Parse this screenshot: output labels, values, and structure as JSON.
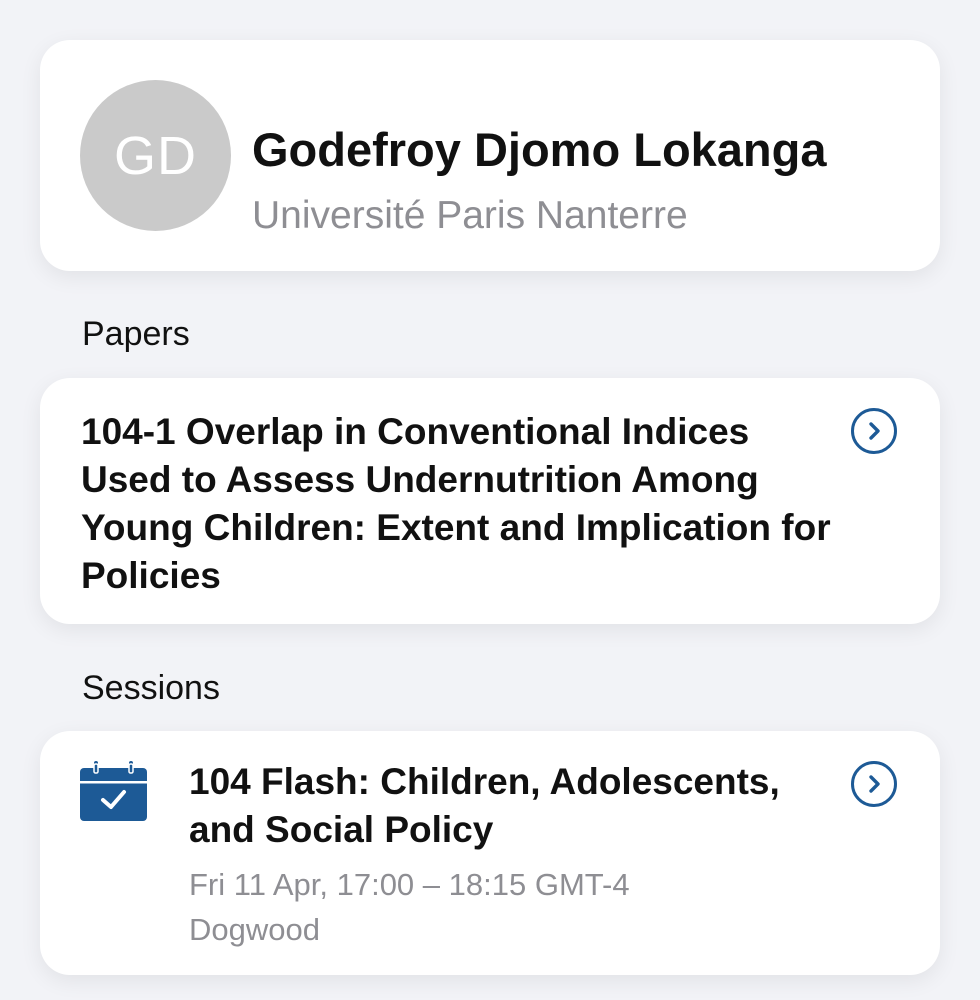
{
  "profile": {
    "initials": "GD",
    "name": "Godefroy Djomo Lokanga",
    "affiliation": "Université Paris Nanterre"
  },
  "papers": {
    "heading": "Papers",
    "items": [
      {
        "title": "104-1 Overlap in Conventional Indices Used to Assess Undernutrition Among Young Children: Extent and Implication for Policies",
        "action_icon": "chevron-right-circle-icon"
      }
    ]
  },
  "sessions": {
    "heading": "Sessions",
    "items": [
      {
        "icon": "calendar-check-icon",
        "title": "104 Flash: Children, Adolescents, and Social Policy",
        "time": "Fri 11 Apr, 17:00 – 18:15 GMT-4",
        "location": "Dogwood",
        "action_icon": "chevron-right-circle-icon"
      }
    ]
  },
  "colors": {
    "accent": "#1d5a96",
    "background": "#f2f3f7",
    "card": "#ffffff",
    "secondary_text": "#8e8e93",
    "avatar_bg": "#cacaca"
  }
}
